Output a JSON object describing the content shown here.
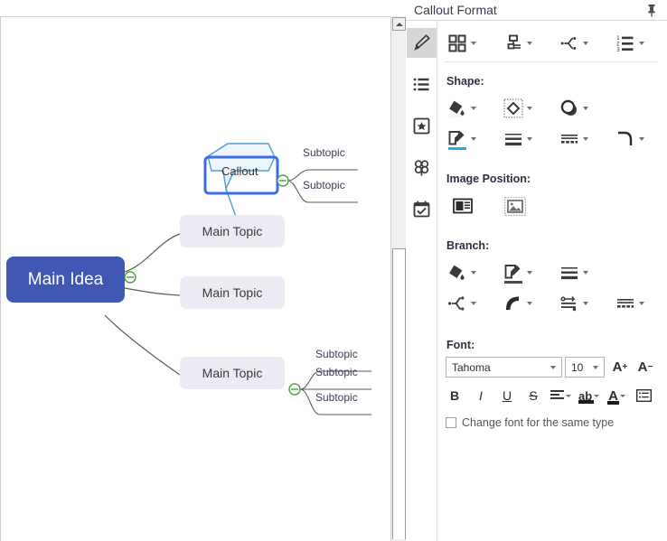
{
  "panel": {
    "title": "Callout Format",
    "pin_icon": "pushpin-icon",
    "tabs": [
      {
        "name": "format-brush",
        "icon": "paint-brush-icon",
        "active": true
      },
      {
        "name": "outline",
        "icon": "bullet-list-icon",
        "active": false
      },
      {
        "name": "frame",
        "icon": "badge-frame-icon",
        "active": false
      },
      {
        "name": "clipart",
        "icon": "clover-clipart-icon",
        "active": false
      },
      {
        "name": "task",
        "icon": "task-calendar-icon",
        "active": false
      }
    ],
    "layout_row": [
      {
        "name": "theme-grid",
        "icon": "grid-squares-icon"
      },
      {
        "name": "map-layout",
        "icon": "org-chart-icon"
      },
      {
        "name": "branch-layout",
        "icon": "branch-bracket-icon"
      },
      {
        "name": "numbering",
        "icon": "numbered-list-icon"
      }
    ],
    "shape": {
      "label": "Shape:",
      "row1": [
        {
          "name": "shape-fill",
          "icon": "fill-bucket-icon"
        },
        {
          "name": "shape-outline",
          "icon": "diamond-shape-icon"
        },
        {
          "name": "shape-shadow",
          "icon": "shadow-circle-icon"
        }
      ],
      "row2": [
        {
          "name": "shape-line-color",
          "icon": "pen-edit-icon"
        },
        {
          "name": "shape-line-weight",
          "icon": "line-weight-icon"
        },
        {
          "name": "shape-line-style",
          "icon": "dashed-line-icon"
        },
        {
          "name": "shape-corner",
          "icon": "rounded-corner-icon"
        }
      ]
    },
    "image_position": {
      "label": "Image Position:",
      "items": [
        {
          "name": "image-left-text-right",
          "icon": "image-with-text-icon"
        },
        {
          "name": "image-only",
          "icon": "image-placeholder-icon"
        }
      ]
    },
    "branch": {
      "label": "Branch:",
      "row1": [
        {
          "name": "branch-fill",
          "icon": "fill-bucket-icon"
        },
        {
          "name": "branch-line-color",
          "icon": "pen-edit-icon"
        },
        {
          "name": "branch-line-weight",
          "icon": "line-weight-icon"
        }
      ],
      "row2": [
        {
          "name": "branch-layout-style",
          "icon": "branch-bracket-icon"
        },
        {
          "name": "branch-curve",
          "icon": "curve-arc-icon"
        },
        {
          "name": "branch-arrow",
          "icon": "arrow-style-icon"
        },
        {
          "name": "branch-line-dash",
          "icon": "dashed-line-icon"
        }
      ]
    },
    "font": {
      "label": "Font:",
      "family": "Tahoma",
      "size": "10",
      "increase_label": "A",
      "increase_sup": "+",
      "decrease_label": "A",
      "decrease_sup": "−",
      "bold": "B",
      "italic": "I",
      "underline": "U",
      "strikethrough": "S",
      "align_icon": "align-left-icon",
      "highlight_label": "ab",
      "color_label": "A",
      "list_icon": "text-list-icon",
      "checkbox_label": "Change font for the same type",
      "checkbox_checked": false
    }
  },
  "canvas": {
    "main_idea": {
      "label": "Main Idea",
      "color": "#4058b4",
      "text_color": "#ffffff"
    },
    "main_topics": [
      {
        "label": "Main Topic"
      },
      {
        "label": "Main Topic"
      },
      {
        "label": "Main Topic"
      }
    ],
    "callout": {
      "label": "Callout",
      "selected": true,
      "stroke": "#4d9fd8",
      "selection_color": "#3d6ee0"
    },
    "callout_subtopics": [
      {
        "label": "Subtopic"
      },
      {
        "label": "Subtopic"
      }
    ],
    "topic3_subtopics": [
      {
        "label": "Subtopic"
      },
      {
        "label": "Subtopic"
      },
      {
        "label": "Subtopic"
      }
    ],
    "collapse_handles": [
      {
        "name": "collapse-handle-main-idea"
      },
      {
        "name": "collapse-handle-callout"
      },
      {
        "name": "collapse-handle-topic3"
      }
    ],
    "node_fill": "#ebebf4",
    "branch_color": "#5a5a5a",
    "handle_color": "#4aa13f"
  }
}
